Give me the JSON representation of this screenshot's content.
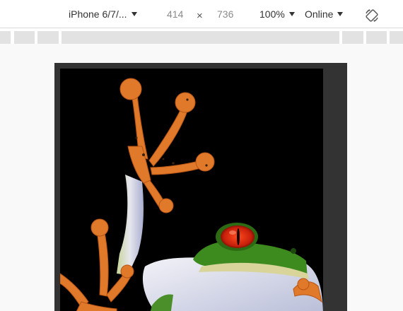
{
  "toolbar": {
    "device": "iPhone 6/7/...",
    "width": "414",
    "separator": "×",
    "height": "736",
    "zoom": "100%",
    "throttling": "Online"
  },
  "icons": {
    "device_dropdown": "chevron-down-icon",
    "zoom_dropdown": "chevron-down-icon",
    "throttling_dropdown": "chevron-down-icon",
    "rotate": "rotate-icon"
  },
  "colors": {
    "frame": "#333333",
    "viewport_background": "#f9f9f9",
    "ruler_segment": "#e2e2e2",
    "frog_orange": "#e07a2a",
    "frog_green": "#3d8b1f",
    "frog_eye": "#d32a12"
  }
}
